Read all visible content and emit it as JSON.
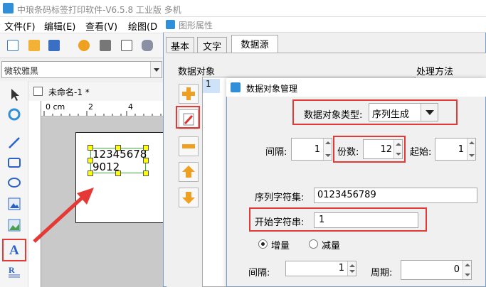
{
  "main_window": {
    "title": "中琅条码标签打印软件-V6.5.8 工业版 多机",
    "menu": [
      "文件(F)",
      "编辑(E)",
      "查看(V)",
      "绘图(D"
    ],
    "font_name": "微软雅黑",
    "doc_tab": "未命名-1 *",
    "ruler_labels": [
      "0 cm",
      "2",
      "4"
    ],
    "label_text_line1": "12345678",
    "label_text_line2": "9012"
  },
  "props_dialog": {
    "title": "图形属性",
    "tabs": [
      "基本",
      "文字",
      "数据源"
    ],
    "active_tab": "数据源",
    "group_data_object": "数据对象",
    "group_process": "处理方法",
    "list_rows": [
      "1"
    ]
  },
  "dom_dialog": {
    "title": "数据对象管理",
    "type_label": "数据对象类型:",
    "type_value": "序列生成",
    "interval_label": "间隔:",
    "interval_value": "1",
    "copies_label": "份数:",
    "copies_value": "12",
    "start_label": "起始:",
    "start_value": "1",
    "charset_label": "序列字符集:",
    "charset_value": "0123456789",
    "start_string_label": "开始字符串:",
    "start_string_value": "1",
    "increase_label": "增量",
    "decrease_label": "减量",
    "interval2_label": "间隔:",
    "interval2_value": "1",
    "period_label": "周期:",
    "period_value": "0"
  },
  "colors": {
    "highlight": "#e53935",
    "handle": "#ffff00",
    "selection": "#3cb43c",
    "accent": "#2f8fd8"
  }
}
